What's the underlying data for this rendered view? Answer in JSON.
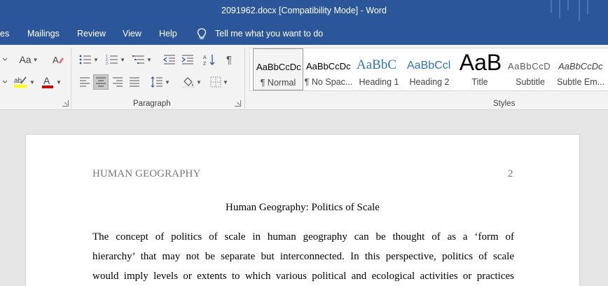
{
  "window": {
    "title": "2091962.docx [Compatibility Mode]  -  Word"
  },
  "menu": {
    "tabs": [
      "es",
      "Mailings",
      "Review",
      "View",
      "Help"
    ],
    "tell_me": "Tell me what you want to do"
  },
  "ribbon": {
    "font_group": {
      "change_case": "Aa"
    },
    "paragraph_group": {
      "label": "Paragraph"
    },
    "styles_group": {
      "label": "Styles",
      "items": [
        {
          "sample": "AaBbCcDc",
          "name": "¶ Normal"
        },
        {
          "sample": "AaBbCcDc",
          "name": "¶ No Spac..."
        },
        {
          "sample": "AaBbC",
          "name": "Heading 1"
        },
        {
          "sample": "AaBbCcl",
          "name": "Heading 2"
        },
        {
          "sample": "AaB",
          "name": "Title"
        },
        {
          "sample": "AaBbCcD",
          "name": "Subtitle"
        },
        {
          "sample": "AaBbCcDc",
          "name": "Subtle Em..."
        }
      ]
    },
    "colors": {
      "highlight": "#ffff00",
      "font_color": "#c00000"
    }
  },
  "document": {
    "running_head": "HUMAN GEOGRAPHY",
    "page_number": "2",
    "title": "Human Geography: Politics of Scale",
    "lines": [
      "The concept of politics of scale in human geography can be thought of as a ‘form of",
      "hierarchy’ that may not be separate but interconnected. In this perspective, politics of scale",
      "would imply levels or extents to which various political and ecological activities or practices"
    ]
  },
  "theme": {
    "accent": "#2b579a"
  }
}
